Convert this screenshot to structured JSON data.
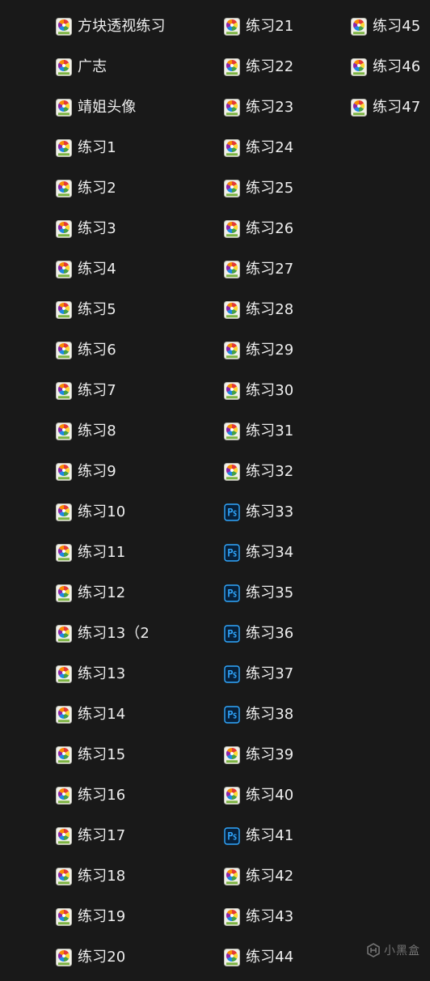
{
  "icons": {
    "sai": "sai-file-icon",
    "ps": "photoshop-file-icon"
  },
  "columns": [
    {
      "items": [
        {
          "label": "方块透视练习",
          "type": "sai"
        },
        {
          "label": "广志",
          "type": "sai"
        },
        {
          "label": "靖姐头像",
          "type": "sai"
        },
        {
          "label": "练习1",
          "type": "sai"
        },
        {
          "label": "练习2",
          "type": "sai"
        },
        {
          "label": "练习3",
          "type": "sai"
        },
        {
          "label": "练习4",
          "type": "sai"
        },
        {
          "label": "练习5",
          "type": "sai"
        },
        {
          "label": "练习6",
          "type": "sai"
        },
        {
          "label": "练习7",
          "type": "sai"
        },
        {
          "label": "练习8",
          "type": "sai"
        },
        {
          "label": "练习9",
          "type": "sai"
        },
        {
          "label": "练习10",
          "type": "sai"
        },
        {
          "label": "练习11",
          "type": "sai"
        },
        {
          "label": "练习12",
          "type": "sai"
        },
        {
          "label": "练习13（2",
          "type": "sai"
        },
        {
          "label": "练习13",
          "type": "sai"
        },
        {
          "label": "练习14",
          "type": "sai"
        },
        {
          "label": "练习15",
          "type": "sai"
        },
        {
          "label": "练习16",
          "type": "sai"
        },
        {
          "label": "练习17",
          "type": "sai"
        },
        {
          "label": "练习18",
          "type": "sai"
        },
        {
          "label": "练习19",
          "type": "sai"
        },
        {
          "label": "练习20",
          "type": "sai"
        }
      ]
    },
    {
      "items": [
        {
          "label": "练习21",
          "type": "sai"
        },
        {
          "label": "练习22",
          "type": "sai"
        },
        {
          "label": "练习23",
          "type": "sai"
        },
        {
          "label": "练习24",
          "type": "sai"
        },
        {
          "label": "练习25",
          "type": "sai"
        },
        {
          "label": "练习26",
          "type": "sai"
        },
        {
          "label": "练习27",
          "type": "sai"
        },
        {
          "label": "练习28",
          "type": "sai"
        },
        {
          "label": "练习29",
          "type": "sai"
        },
        {
          "label": "练习30",
          "type": "sai"
        },
        {
          "label": "练习31",
          "type": "sai"
        },
        {
          "label": "练习32",
          "type": "sai"
        },
        {
          "label": "练习33",
          "type": "ps"
        },
        {
          "label": "练习34",
          "type": "ps"
        },
        {
          "label": "练习35",
          "type": "ps"
        },
        {
          "label": "练习36",
          "type": "ps"
        },
        {
          "label": "练习37",
          "type": "ps"
        },
        {
          "label": "练习38",
          "type": "ps"
        },
        {
          "label": "练习39",
          "type": "sai"
        },
        {
          "label": "练习40",
          "type": "sai"
        },
        {
          "label": "练习41",
          "type": "ps"
        },
        {
          "label": "练习42",
          "type": "sai"
        },
        {
          "label": "练习43",
          "type": "sai"
        },
        {
          "label": "练习44",
          "type": "sai"
        }
      ]
    },
    {
      "items": [
        {
          "label": "练习45",
          "type": "sai"
        },
        {
          "label": "练习46",
          "type": "sai"
        },
        {
          "label": "练习47",
          "type": "sai"
        }
      ]
    }
  ],
  "watermark": {
    "text": "小黑盒",
    "icon": "heybox-logo-icon"
  }
}
